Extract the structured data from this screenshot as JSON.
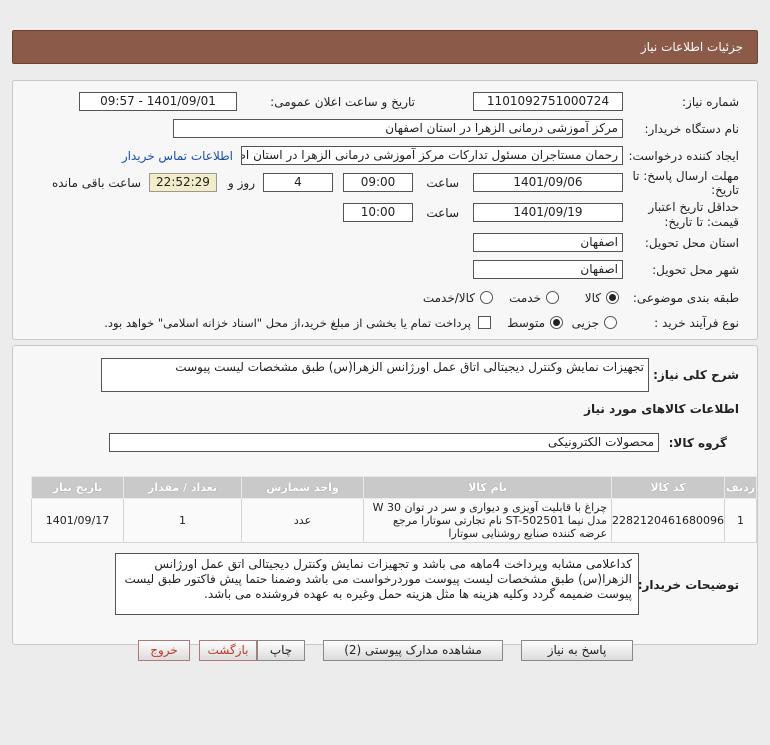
{
  "header": {
    "title": "جزئیات اطلاعات نیاز"
  },
  "need": {
    "number_label": "شماره نیاز:",
    "number": "1101092751000724",
    "announce_label": "تاریخ و ساعت اعلان عمومی:",
    "announce": "1401/09/01 - 09:57",
    "buyer_org_label": "نام دستگاه خریدار:",
    "buyer_org": "مرکز آموزشی درمانی الزهرا در استان اصفهان",
    "creator_label": "ایجاد کننده درخواست:",
    "creator": "رحمان مستاجران مسئول تدارکات مرکز آموزشی درمانی الزهرا در استان اصفهان",
    "contact_link": "اطلاعات تماس خریدار",
    "send_deadline_label_1": "مهلت ارسال پاسخ: تا",
    "send_deadline_label_2": "تاریخ:",
    "send_date": "1401/09/06",
    "time_label": "ساعت",
    "send_time": "09:00",
    "days": "4",
    "days_label": "روز و",
    "remaining": "22:52:29",
    "remaining_label": "ساعت باقی مانده",
    "validity_label_1": "حداقل تاریخ اعتبار",
    "validity_label_2": "قیمت: تا تاریخ:",
    "validity_date": "1401/09/19",
    "validity_time": "10:00",
    "province_label": "استان محل تحویل:",
    "province": "اصفهان",
    "city_label": "شهر محل تحویل:",
    "city": "اصفهان",
    "category_label": "طبقه بندی موضوعی:",
    "category_options": [
      "کالا",
      "خدمت",
      "کالا/خدمت"
    ],
    "process_label": "نوع فرآیند خرید :",
    "process_options": [
      "جزیی",
      "متوسط"
    ],
    "treasury_note": "پرداخت تمام یا بخشی از مبلغ خرید،از محل \"اسناد خزانه اسلامی\" خواهد بود."
  },
  "details": {
    "summary_label": "شرح کلی نیاز:",
    "summary": "تجهیزات نمایش وکنترل دیجیتالی اتاق عمل اورژانس الزهرا(س) طبق مشخصات لیست پیوست",
    "goods_info_title": "اطلاعات کالاهای مورد نیاز",
    "group_label": "گروه کالا:",
    "group": "محصولات الکترونیکی",
    "columns": [
      "ردیف",
      "کد کالا",
      "نام کالا",
      "واحد شمارش",
      "تعداد / مقدار",
      "تاریخ نیاز"
    ],
    "rows": [
      {
        "index": "1",
        "code": "2282120461680096",
        "name": "چراغ با قابلیت آویزی و دیواری و سر در توان 30 W مدل نیما ST-502501 نام تجارتی سوتارا مرجع عرضه کننده صنایع روشنایی سوتارا",
        "unit": "عدد",
        "qty": "1",
        "date": "1401/09/17"
      }
    ],
    "buyer_notes_label": "توضیحات خریدار:",
    "buyer_notes": "کداعلامی مشابه وپرداخت 4ماهه می باشد و تجهیزات نمایش وکنترل دیجیتالی اتق عمل اورژانس الزهرا(س) طبق مشخصات لیست پیوست موردرخواست می باشد وضمنا حتما پیش فاکتور طبق لیست پیوست ضمیمه گردد وکلیه هزینه ها مثل هزینه حمل وغیره به عهده فروشنده می باشد."
  },
  "buttons": {
    "reply": "پاسخ به نیاز",
    "attachments": "مشاهده مدارک پیوستی (2)",
    "print": "چاپ",
    "back": "بازگشت",
    "exit": "خروج"
  },
  "colors": {
    "header_bg": "#8b5a48",
    "link": "#1a4fb0",
    "remaining_bg": "#f2ecc8"
  }
}
